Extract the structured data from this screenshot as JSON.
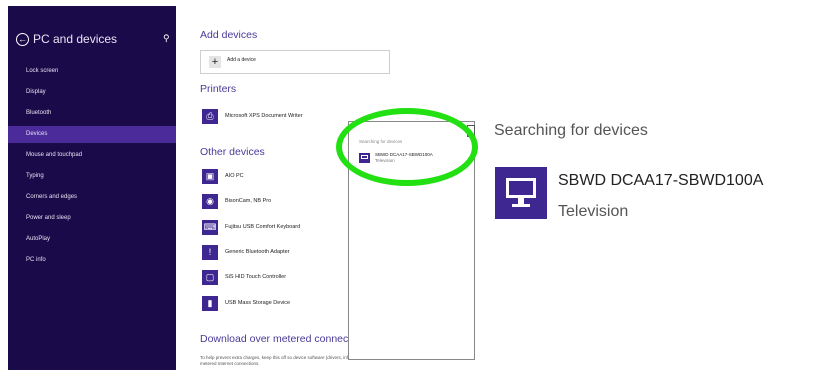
{
  "sidebar": {
    "title": "PC and devices",
    "back_icon": "back-arrow-icon",
    "search_icon": "search-icon",
    "items": [
      {
        "label": "Lock screen",
        "selected": false
      },
      {
        "label": "Display",
        "selected": false
      },
      {
        "label": "Bluetooth",
        "selected": false
      },
      {
        "label": "Devices",
        "selected": true
      },
      {
        "label": "Mouse and touchpad",
        "selected": false
      },
      {
        "label": "Typing",
        "selected": false
      },
      {
        "label": "Corners and edges",
        "selected": false
      },
      {
        "label": "Power and sleep",
        "selected": false
      },
      {
        "label": "AutoPlay",
        "selected": false
      },
      {
        "label": "PC info",
        "selected": false
      }
    ],
    "colors": {
      "background": "#1b0a4a",
      "selected": "#4b2a9a"
    }
  },
  "main": {
    "add_devices_heading": "Add devices",
    "add_device_label": "Add a device",
    "printers_heading": "Printers",
    "printers": [
      {
        "label": "Microsoft XPS Document Writer",
        "icon": "printer-icon"
      }
    ],
    "other_devices_heading": "Other devices",
    "other_devices": [
      {
        "label": "AIO PC",
        "icon": "monitor-icon"
      },
      {
        "label": "BisonCam, NB Pro",
        "icon": "webcam-icon"
      },
      {
        "label": "Fujitsu USB Comfort Keyboard",
        "icon": "keyboard-icon"
      },
      {
        "label": "Generic Bluetooth Adapter",
        "icon": "warning-icon"
      },
      {
        "label": "SiS HID Touch Controller",
        "icon": "touch-icon"
      },
      {
        "label": "USB Mass Storage Device",
        "icon": "usb-drive-icon"
      }
    ],
    "metered_heading": "Download over metered connections",
    "metered_text": "To help prevent extra charges, keep this off so device software (drivers, info, and apps) for new devices won't download while you're on metered Internet connections.",
    "accent_color": "#3e2790"
  },
  "popup": {
    "searching_label": "Searching for devices",
    "item_name": "SBWD DCAA17-SBWD100A",
    "item_type": "Television"
  },
  "detail": {
    "title": "Searching for devices",
    "device_name": "SBWD DCAA17-SBWD100A",
    "device_type": "Television",
    "highlight_color": "#22e011"
  }
}
